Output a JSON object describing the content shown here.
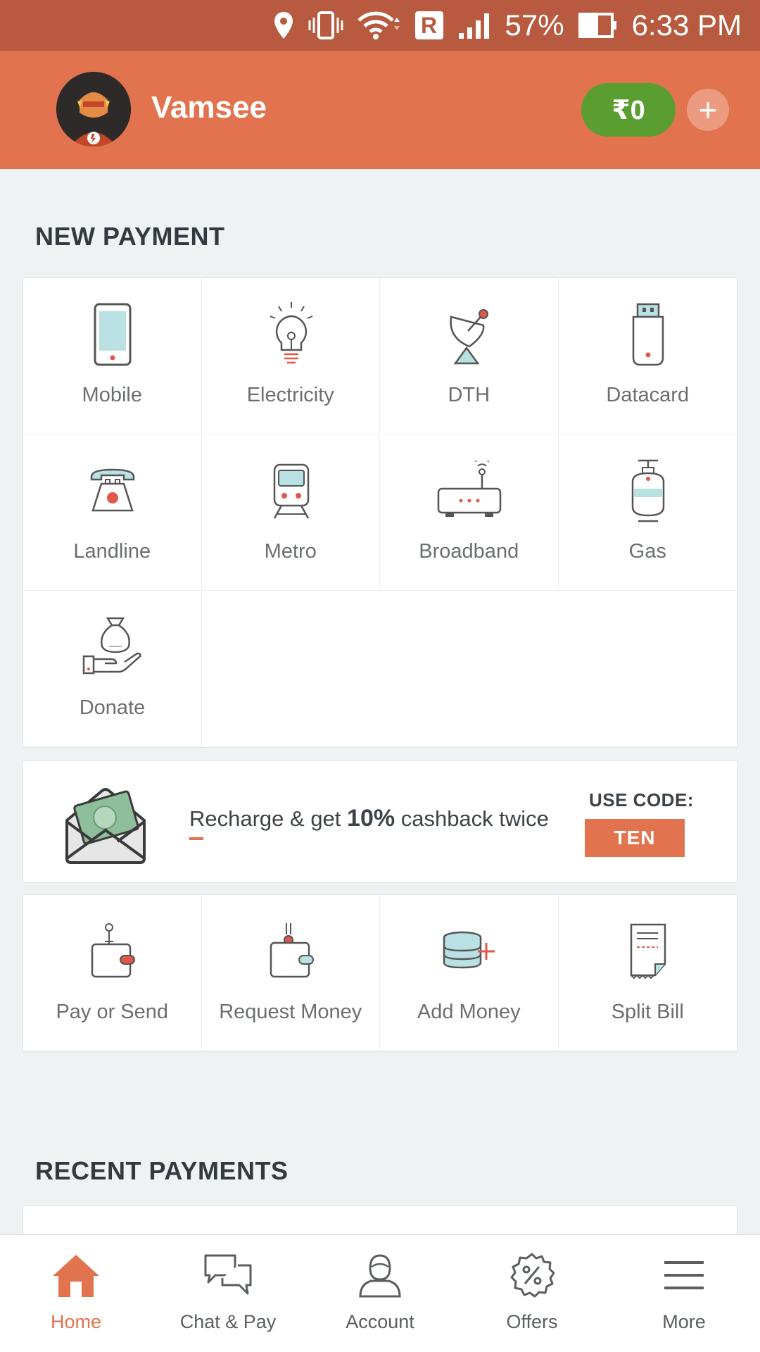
{
  "status_bar": {
    "battery": "57%",
    "time": "6:33 PM",
    "roaming": "R",
    "icons": [
      "location-icon",
      "vibrate-icon",
      "wifi-icon",
      "signal-icon",
      "battery-icon"
    ]
  },
  "header": {
    "user_name": "Vamsee",
    "balance": "₹0",
    "add_label": "+"
  },
  "new_payment": {
    "title": "NEW PAYMENT",
    "tiles": [
      {
        "label": "Mobile",
        "icon": "mobile-icon"
      },
      {
        "label": "Electricity",
        "icon": "bulb-icon"
      },
      {
        "label": "DTH",
        "icon": "satellite-dish-icon"
      },
      {
        "label": "Datacard",
        "icon": "usb-dongle-icon"
      },
      {
        "label": "Landline",
        "icon": "telephone-icon"
      },
      {
        "label": "Metro",
        "icon": "train-icon"
      },
      {
        "label": "Broadband",
        "icon": "router-icon"
      },
      {
        "label": "Gas",
        "icon": "gas-cylinder-icon"
      },
      {
        "label": "Donate",
        "icon": "donate-icon"
      }
    ]
  },
  "promo": {
    "text_pre": "Recharge & get ",
    "text_highlight": "10%",
    "text_post": " cashback twice",
    "use_code_label": "USE CODE:",
    "code": "TEN"
  },
  "wallet_actions": [
    {
      "label": "Pay or Send",
      "icon": "wallet-pay-icon"
    },
    {
      "label": "Request Money",
      "icon": "wallet-request-icon"
    },
    {
      "label": "Add Money",
      "icon": "add-money-icon"
    },
    {
      "label": "Split Bill",
      "icon": "receipt-icon"
    }
  ],
  "recent_payments": {
    "title": "RECENT PAYMENTS"
  },
  "bottom_nav": [
    {
      "label": "Home",
      "icon": "home-icon",
      "active": true
    },
    {
      "label": "Chat & Pay",
      "icon": "chat-icon",
      "active": false
    },
    {
      "label": "Account",
      "icon": "account-icon",
      "active": false
    },
    {
      "label": "Offers",
      "icon": "offers-icon",
      "active": false
    },
    {
      "label": "More",
      "icon": "menu-icon",
      "active": false
    }
  ],
  "colors": {
    "accent": "#e1734e",
    "status_bar": "#b75a3f",
    "balance_green": "#5a9e32",
    "background": "#eef2f2"
  }
}
